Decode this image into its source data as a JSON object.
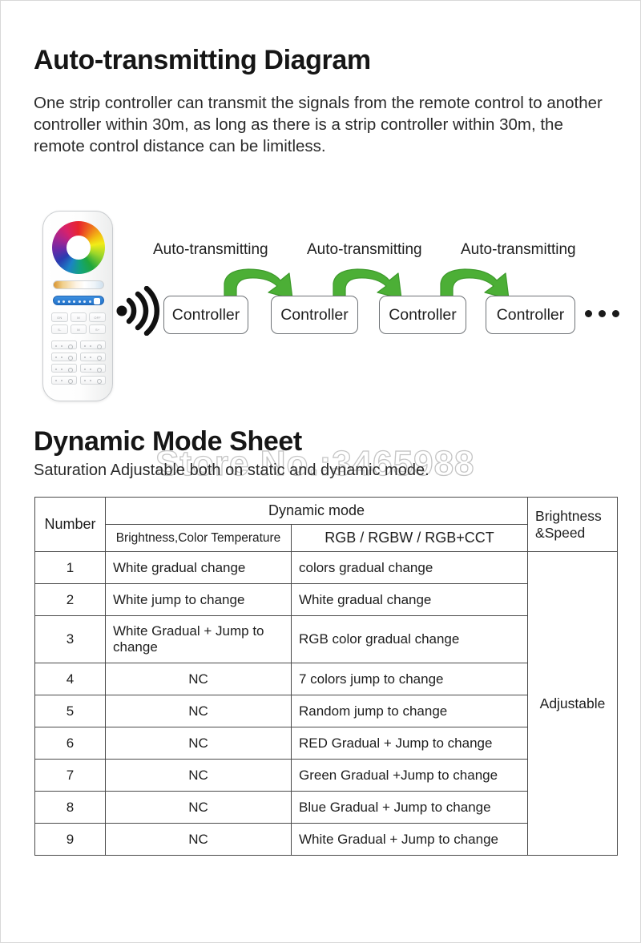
{
  "sections": {
    "auto": {
      "title": "Auto-transmitting Diagram",
      "paragraph": "One strip controller can transmit the signals from the remote control to another controller within 30m, as long as there is a strip controller within 30m, the remote control distance can be limitless."
    },
    "dynamic": {
      "title": "Dynamic Mode Sheet",
      "subtitle": "Saturation Adjustable both on static and dynamic mode."
    }
  },
  "watermark": "Store No.:3465988",
  "diagram": {
    "remote": {
      "top_keys": [
        "ON",
        "M",
        "OFF",
        "S-",
        "M",
        "S+"
      ]
    },
    "auto_labels": [
      "Auto-transmitting",
      "Auto-transmitting",
      "Auto-transmitting"
    ],
    "controllers": [
      "Controller",
      "Controller",
      "Controller",
      "Controller"
    ],
    "arrow_color": "#4caf36",
    "ellipsis": "• • •"
  },
  "table": {
    "headers": {
      "number": "Number",
      "dynamic_mode": "Dynamic mode",
      "brightness_cct": "Brightness,Color Temperature",
      "rgb": "RGB / RGBW / RGB+CCT",
      "brightness_speed": "Brightness\n&Speed"
    },
    "brightness_speed_value": "Adjustable",
    "rows": [
      {
        "number": "1",
        "bct": "White gradual change",
        "rgb": "colors gradual change"
      },
      {
        "number": "2",
        "bct": "White jump to change",
        "rgb": "White gradual change"
      },
      {
        "number": "3",
        "bct": "White Gradual + Jump to change",
        "rgb": "RGB color gradual change"
      },
      {
        "number": "4",
        "bct": "NC",
        "rgb": "7 colors jump to change"
      },
      {
        "number": "5",
        "bct": "NC",
        "rgb": "Random jump to change"
      },
      {
        "number": "6",
        "bct": "NC",
        "rgb": "RED Gradual + Jump to change"
      },
      {
        "number": "7",
        "bct": "NC",
        "rgb": "Green Gradual +Jump to change"
      },
      {
        "number": "8",
        "bct": "NC",
        "rgb": "Blue Gradual + Jump to change"
      },
      {
        "number": "9",
        "bct": "NC",
        "rgb": "White Gradual + Jump to change"
      }
    ]
  }
}
